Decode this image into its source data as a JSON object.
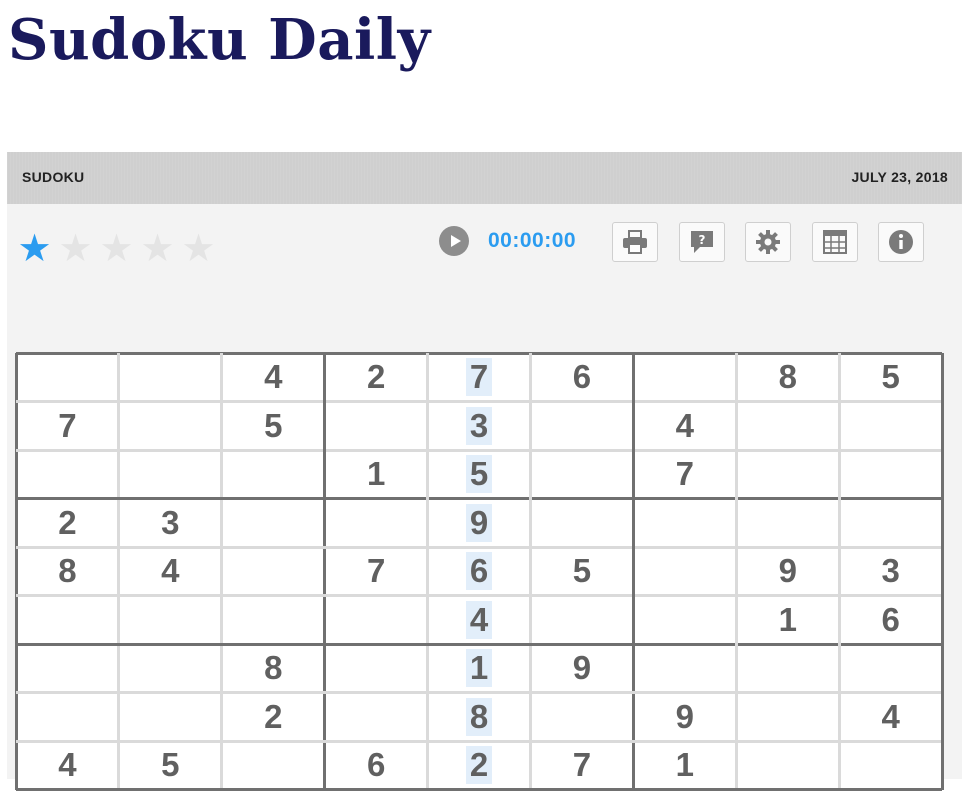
{
  "site_title": "Sudoku Daily",
  "header": {
    "left": "SUDOKU",
    "right": "JULY 23, 2018"
  },
  "difficulty": {
    "stars_total": 5,
    "stars_filled": 1,
    "star_glyph": "★"
  },
  "timer": "00:00:00",
  "toolbar": [
    "print-icon",
    "hint-icon",
    "settings-icon",
    "notes-grid-icon",
    "info-icon"
  ],
  "colors": {
    "title": "#1a1a5c",
    "accent": "#2b9cf0",
    "highlight_column": "#e2eefa"
  },
  "highlighted_column_index": 4,
  "grid": [
    [
      "",
      "",
      "4",
      "2",
      "7",
      "6",
      "",
      "8",
      "5"
    ],
    [
      "7",
      "",
      "5",
      "",
      "3",
      "",
      "4",
      "",
      ""
    ],
    [
      "",
      "",
      "",
      "1",
      "5",
      "",
      "7",
      "",
      ""
    ],
    [
      "2",
      "3",
      "",
      "",
      "9",
      "",
      "",
      "",
      ""
    ],
    [
      "8",
      "4",
      "",
      "7",
      "6",
      "5",
      "",
      "9",
      "3"
    ],
    [
      "",
      "",
      "",
      "",
      "4",
      "",
      "",
      "1",
      "6"
    ],
    [
      "",
      "",
      "8",
      "",
      "1",
      "9",
      "",
      "",
      ""
    ],
    [
      "",
      "",
      "2",
      "",
      "8",
      "",
      "9",
      "",
      "4"
    ],
    [
      "4",
      "5",
      "",
      "6",
      "2",
      "7",
      "1",
      "",
      ""
    ]
  ]
}
